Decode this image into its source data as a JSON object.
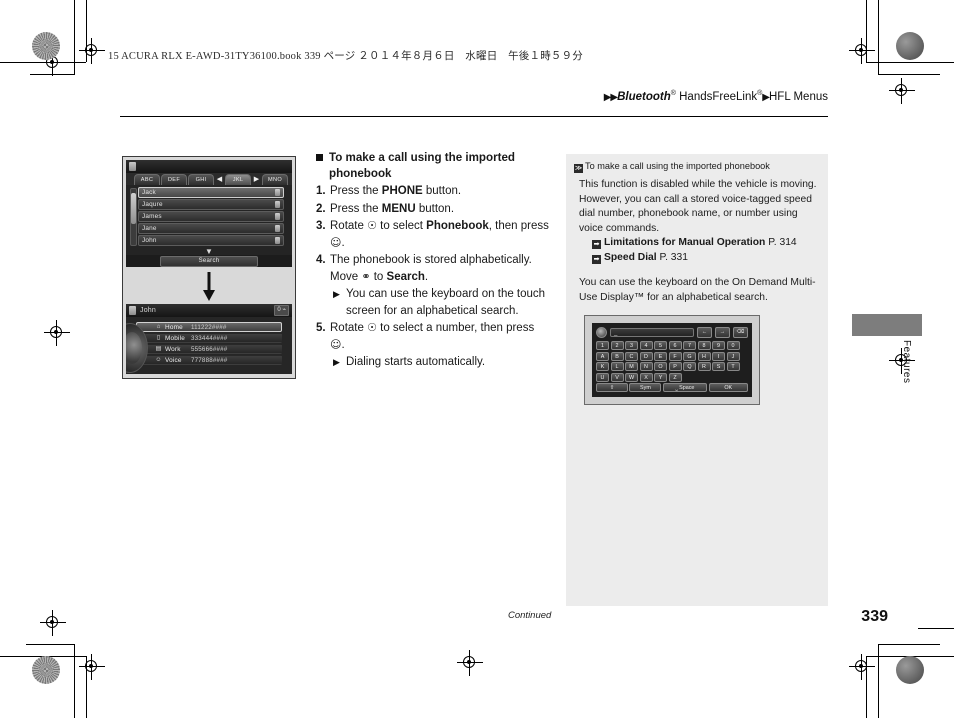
{
  "book_header": "15 ACURA RLX E-AWD-31TY36100.book   339 ページ   ２０１４年８月６日　水曜日　午後１時５９分",
  "running_head": {
    "arrows": "▶▶",
    "brand": "Bluetooth",
    "brand_sup": "®",
    "product": " HandsFreeLink",
    "product_sup": "®",
    "sep": "▶",
    "section": "HFL Menus"
  },
  "instructions": {
    "heading": "To make a call using the imported phonebook",
    "steps": [
      {
        "n": "1.",
        "html": "Press the <b>PHONE</b> button."
      },
      {
        "n": "2.",
        "html": "Press the <b>MENU</b> button."
      },
      {
        "n": "3.",
        "html": "Rotate <span class=\"gl\">&#9737;</span> to select <b>Phonebook</b>, then press <span class=\"gl\">&#9786;</span>."
      },
      {
        "n": "4.",
        "html": "The phonebook is stored alphabetically. Move <span class=\"gl\">&#9901;</span> to <b>Search</b>."
      },
      {
        "n": "5.",
        "html": "Rotate <span class=\"gl\">&#9737;</span> to select a number, then press <span class=\"gl\">&#9786;</span>."
      }
    ],
    "sub_after_4": "You can use the keyboard on the touch screen for an alphabetical search.",
    "sub_after_5": "Dialing starts automatically."
  },
  "notes": {
    "title": "To make a call using the imported phonebook",
    "title_marker": "≫",
    "paragraph1": "This function is disabled while the vehicle is moving. However, you can call a stored voice-tagged speed dial number, phonebook name, or number using voice commands.",
    "refs": [
      {
        "marker": "➡",
        "label": "Limitations for Manual Operation",
        "page": "P. 314"
      },
      {
        "marker": "➡",
        "label": "Speed Dial",
        "page": "P. 331"
      }
    ],
    "paragraph2": "You can use the keyboard on the On Demand Multi-Use Display™ for an alphabetical search."
  },
  "screen_phonebook": {
    "title": "",
    "tabs": [
      "ABC",
      "DEF",
      "GHI",
      "JKL",
      "MNO"
    ],
    "selected_tab": "JKL",
    "left_arrow": "◀",
    "right_arrow": "▶",
    "entries": [
      "Jack",
      "Jaqure",
      "James",
      "Jane",
      "John"
    ],
    "selected_entry": "Jack",
    "search_label": "Search",
    "caret": "▼"
  },
  "screen_detail": {
    "title": "John",
    "status": "0 ⌁",
    "rows": [
      {
        "icon": "⌂",
        "label": "Home",
        "value": "111222####"
      },
      {
        "icon": "▯",
        "label": "Mobile",
        "value": "333444####"
      },
      {
        "icon": "▤",
        "label": "Work",
        "value": "555666####"
      },
      {
        "icon": "☺",
        "label": "Voice",
        "value": "777888####"
      }
    ],
    "selected_row": "Home"
  },
  "keyboard": {
    "input_value": "_",
    "back_icon": "⏎",
    "controls": [
      "←",
      "→",
      "⌫"
    ],
    "rows": [
      [
        "1",
        "2",
        "3",
        "4",
        "5",
        "6",
        "7",
        "8",
        "9",
        "0"
      ],
      [
        "A",
        "B",
        "C",
        "D",
        "E",
        "F",
        "G",
        "H",
        "I",
        "J"
      ],
      [
        "K",
        "L",
        "M",
        "N",
        "O",
        "P",
        "Q",
        "R",
        "S",
        "T"
      ],
      [
        "U",
        "V",
        "W",
        "X",
        "Y",
        "Z"
      ]
    ],
    "bottom": [
      "⇧",
      "Sym",
      "⎵ Space",
      "OK"
    ]
  },
  "side_tab_label": "Features",
  "footer": {
    "continued": "Continued",
    "page_number": "339"
  }
}
